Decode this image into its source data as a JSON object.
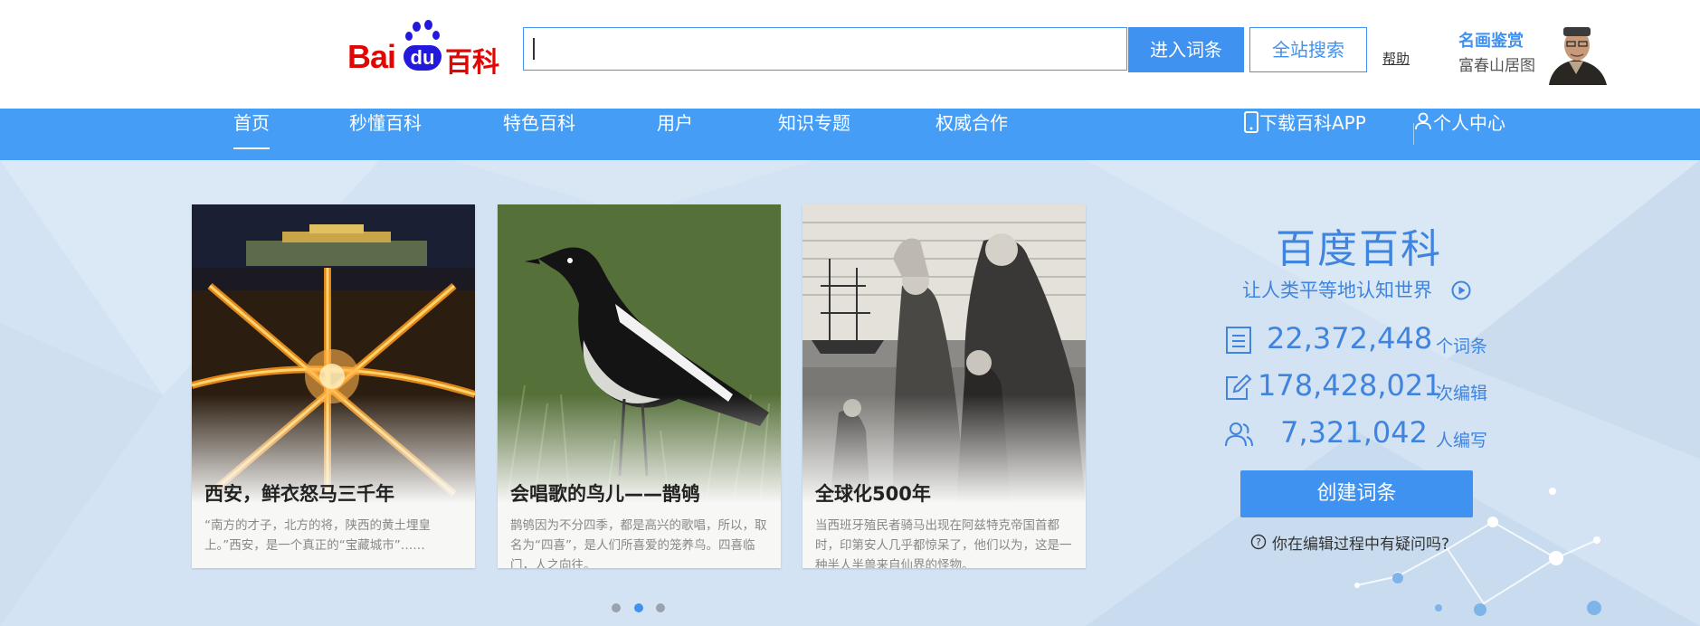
{
  "header": {
    "logo": {
      "bai": "Bai",
      "du": "du",
      "baike": "百科"
    },
    "search": {
      "value": "",
      "placeholder": ""
    },
    "enter_button": "进入词条",
    "site_search_button": "全站搜索",
    "help_link": "帮助",
    "promo": {
      "title": "名画鉴赏",
      "subtitle": "富春山居图"
    }
  },
  "nav": {
    "items": [
      {
        "label": "首页",
        "active": true
      },
      {
        "label": "秒懂百科"
      },
      {
        "label": "特色百科"
      },
      {
        "label": "用户"
      },
      {
        "label": "知识专题"
      },
      {
        "label": "权威合作"
      }
    ],
    "download_app": "下载百科APP",
    "personal_center": "个人中心"
  },
  "cards": [
    {
      "title": "西安，鲜衣怒马三千年",
      "desc": "“南方的才子，北方的将，陕西的黄土埋皇上。”西安，是一个真正的“宝藏城市”……"
    },
    {
      "title": "会唱歌的鸟儿——鹊鸲",
      "desc": "鹊鸲因为不分四季，都是高兴的歌唱，所以，取名为“四喜”，是人们所喜爱的笼养鸟。四喜临门，人之向往。"
    },
    {
      "title": "全球化500年",
      "desc": "当西班牙殖民者骑马出现在阿兹特克帝国首都时，印第安人几乎都惊呆了，他们以为，这是一种半人半兽来自仙界的怪物。"
    }
  ],
  "carousel": {
    "count": 3,
    "active_index": 1
  },
  "brand": {
    "title": "百度百科",
    "slogan": "让人类平等地认知世界"
  },
  "stats": [
    {
      "icon": "list-icon",
      "value": "22,372,448",
      "unit": "个词条"
    },
    {
      "icon": "edit-icon",
      "value": "178,428,021",
      "unit": "次编辑"
    },
    {
      "icon": "users-icon",
      "value": "7,321,042",
      "unit": "人编写"
    }
  ],
  "create_button": "创建词条",
  "faq": "你在编辑过程中有疑问吗?",
  "colors": {
    "accent": "#3f92f0",
    "nav": "#459df5",
    "logo_red": "#e10601",
    "logo_blue": "#2319dc"
  }
}
